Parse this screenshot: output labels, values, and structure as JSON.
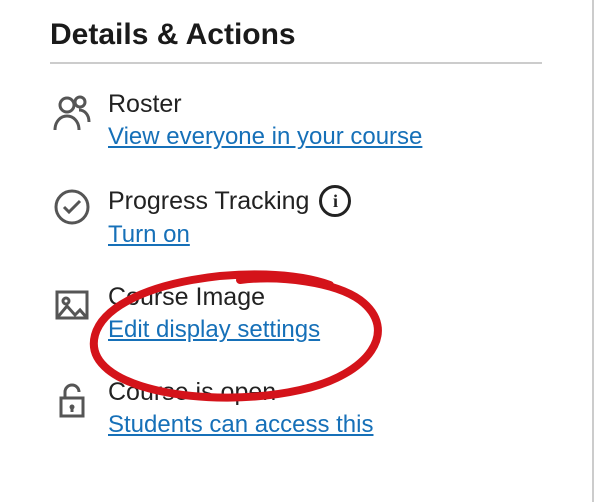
{
  "heading": "Details & Actions",
  "items": [
    {
      "label": "Roster",
      "link": "View everyone in your course"
    },
    {
      "label": "Progress Tracking",
      "link": "Turn on",
      "info": true
    },
    {
      "label": "Course Image",
      "link": "Edit display settings"
    },
    {
      "label": "Course is open",
      "link": "Students can access this"
    }
  ],
  "colors": {
    "link": "#1670b8",
    "annotation": "#d4131a"
  }
}
